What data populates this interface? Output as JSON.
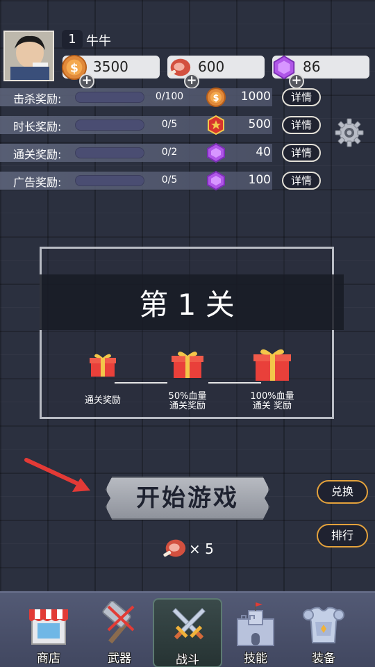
{
  "player": {
    "level": "1",
    "name": "牛牛"
  },
  "resources": [
    {
      "icon": "coin-icon",
      "value": "3500",
      "plus": "+"
    },
    {
      "icon": "meat-icon",
      "value": "600",
      "plus": "+"
    },
    {
      "icon": "gem-icon",
      "value": "86",
      "plus": "+"
    }
  ],
  "rewards": [
    {
      "label": "击杀奖励:",
      "progress": "0/100",
      "fill": 0,
      "icon": "coin-icon",
      "amount": "1000",
      "detail": "详情"
    },
    {
      "label": "时长奖励:",
      "progress": "0/5",
      "fill": 0,
      "icon": "badge-icon",
      "amount": "500",
      "detail": "详情"
    },
    {
      "label": "通关奖励:",
      "progress": "0/2",
      "fill": 0,
      "icon": "gem-icon",
      "amount": "40",
      "detail": "详情"
    },
    {
      "label": "广告奖励:",
      "progress": "0/5",
      "fill": 0,
      "icon": "gem-icon",
      "amount": "100",
      "detail": "详情"
    }
  ],
  "level_panel": {
    "title": "第 1 关",
    "gifts": [
      {
        "label_line1": "通关奖励",
        "label_line2": ""
      },
      {
        "label_line1": "50%血量",
        "label_line2": "通关奖励"
      },
      {
        "label_line1": "100%血量",
        "label_line2": "通关 奖励"
      }
    ]
  },
  "actions": {
    "start": "开始游戏",
    "exchange": "兑换",
    "ranking": "排行",
    "cost_prefix": "×",
    "cost_amount": "5"
  },
  "nav": [
    {
      "label": "商店",
      "icon": "shop-icon",
      "active": false
    },
    {
      "label": "武器",
      "icon": "hammer-icon",
      "active": false
    },
    {
      "label": "战斗",
      "icon": "crossed-swords-icon",
      "active": true
    },
    {
      "label": "技能",
      "icon": "castle-icon",
      "active": false
    },
    {
      "label": "装备",
      "icon": "armor-icon",
      "active": false
    }
  ],
  "colors": {
    "accent_orange": "#e4a23c",
    "progress_track": "#4a4d72",
    "bg": "#2b303f"
  }
}
